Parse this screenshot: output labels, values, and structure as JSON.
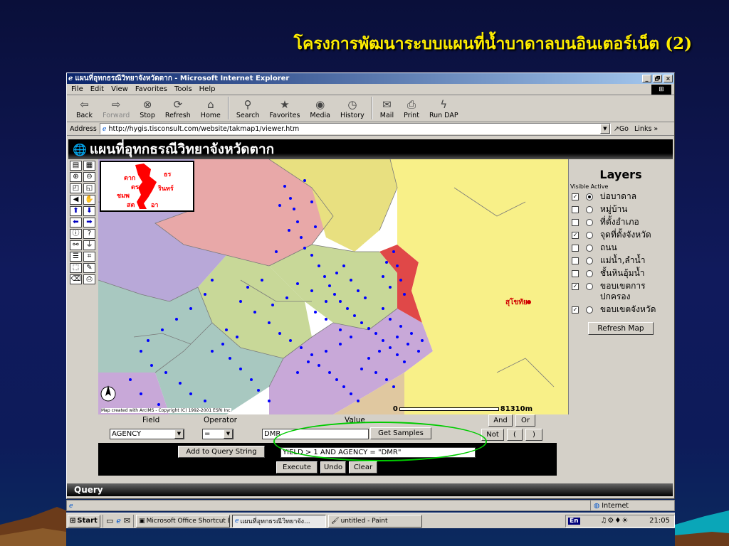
{
  "slide": {
    "title": "โครงการพัฒนาระบบแผนที่น้ำบาดาลบนอินเตอร์เน็ต (2)"
  },
  "window": {
    "title": "แผนที่อุทกธรณีวิทยาจังหวัดตาก - Microsoft Internet Explorer",
    "controls": [
      "_",
      "🗗",
      "×"
    ]
  },
  "menu": [
    "File",
    "Edit",
    "View",
    "Favorites",
    "Tools",
    "Help"
  ],
  "toolbar": [
    {
      "label": "Back",
      "icon": "⇦",
      "name": "back"
    },
    {
      "label": "Forward",
      "icon": "⇨",
      "name": "forward"
    },
    {
      "label": "Stop",
      "icon": "⊗",
      "name": "stop"
    },
    {
      "label": "Refresh",
      "icon": "⟳",
      "name": "refresh"
    },
    {
      "label": "Home",
      "icon": "⌂",
      "name": "home"
    },
    {
      "label": "Search",
      "icon": "⚲",
      "name": "search"
    },
    {
      "label": "Favorites",
      "icon": "★",
      "name": "favorites"
    },
    {
      "label": "Media",
      "icon": "◉",
      "name": "media"
    },
    {
      "label": "History",
      "icon": "◷",
      "name": "history"
    },
    {
      "label": "Mail",
      "icon": "✉",
      "name": "mail"
    },
    {
      "label": "Print",
      "icon": "⎙",
      "name": "print"
    },
    {
      "label": "Run DAP",
      "icon": "ϟ",
      "name": "run-dap"
    }
  ],
  "address": {
    "label": "Address",
    "url": "http://hygis.tisconsult.com/website/takmap1/viewer.htm",
    "go": "Go",
    "links": "Links »"
  },
  "map": {
    "header": "แผนที่อุทกธรณีวิทยาจังหวัดตาก",
    "credit": "Map created with ArcIMS - Copyright (C) 1992-2001 ESRI Inc.",
    "scale_start": "0",
    "scale_end": "81310m",
    "city_label": "สุโขทัย",
    "overview_labels": [
      "ตาก",
      "ธร",
      "ตร",
      "รินทร์",
      "ชมพ",
      "สต",
      "อา"
    ]
  },
  "layers": {
    "title": "Layers",
    "subtitle": "Visible Active",
    "items": [
      {
        "label": "บ่อบาดาล",
        "visible": true,
        "active": true
      },
      {
        "label": "หมู่บ้าน",
        "visible": false,
        "active": false
      },
      {
        "label": "ที่ตั้งอำเภอ",
        "visible": false,
        "active": false
      },
      {
        "label": "จุดที่ตั้งจังหวัด",
        "visible": true,
        "active": false
      },
      {
        "label": "ถนน",
        "visible": false,
        "active": false
      },
      {
        "label": "แม่น้ำ,ลำน้ำ",
        "visible": false,
        "active": false
      },
      {
        "label": "ชั้นหินอุ้มน้ำ",
        "visible": false,
        "active": false
      },
      {
        "label": "ขอบเขตการปกครอง",
        "visible": true,
        "active": false
      },
      {
        "label": "ขอบเขตจังหวัด",
        "visible": true,
        "active": false
      }
    ],
    "refresh": "Refresh Map"
  },
  "query": {
    "field_label": "Field",
    "operator_label": "Operator",
    "value_label": "Value",
    "field_value": "AGENCY",
    "operator_value": "=",
    "value_value": "DMR",
    "get_samples": "Get Samples",
    "and": "And",
    "or": "Or",
    "not": "Not",
    "open_paren": "(",
    "close_paren": ")",
    "add_to_query": "Add to Query String",
    "query_string": "YIELD  >  1 AND AGENCY  =  \"DMR\"",
    "execute": "Execute",
    "undo": "Undo",
    "clear": "Clear",
    "footer": "Query"
  },
  "status": {
    "zone": "Internet"
  },
  "taskbar": {
    "start": "Start",
    "tasks": [
      {
        "label": "Microsoft Office Shortcut Bar",
        "active": false
      },
      {
        "label": "แผนที่อุทกธรณีวิทยาจัง...",
        "active": true
      },
      {
        "label": "untitled - Paint",
        "active": false
      }
    ],
    "lang": "En",
    "clock": "21:05"
  },
  "colors": {
    "title_yellow": "#ffee00",
    "ie_titlebar": "#0a246a",
    "well_dot": "#0000ff",
    "highlight_district": "#e04848"
  }
}
